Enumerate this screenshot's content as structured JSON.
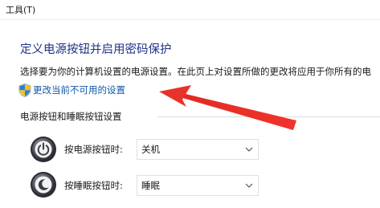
{
  "menubar": {
    "tools_label": "工具(T)"
  },
  "page": {
    "title": "定义电源按钮并启用密码保护",
    "description": "选择要为你的计算机设置的电源设置。在此页上对设置所做的更改将应用于你所有的电",
    "change_link": "更改当前不可用的设置"
  },
  "power_section": {
    "header": "电源按钮和睡眠按钮设置",
    "rows": [
      {
        "label": "按电源按钮时:",
        "selected": "关机",
        "icon": "power-icon"
      },
      {
        "label": "按睡眠按钮时:",
        "selected": "睡眠",
        "icon": "sleep-moon-icon"
      }
    ]
  },
  "colors": {
    "title": "#1e3287",
    "link": "#0f58a8",
    "annotation_arrow": "#e8332a"
  },
  "annotation": {
    "icon": "red-arrow-annotation"
  }
}
